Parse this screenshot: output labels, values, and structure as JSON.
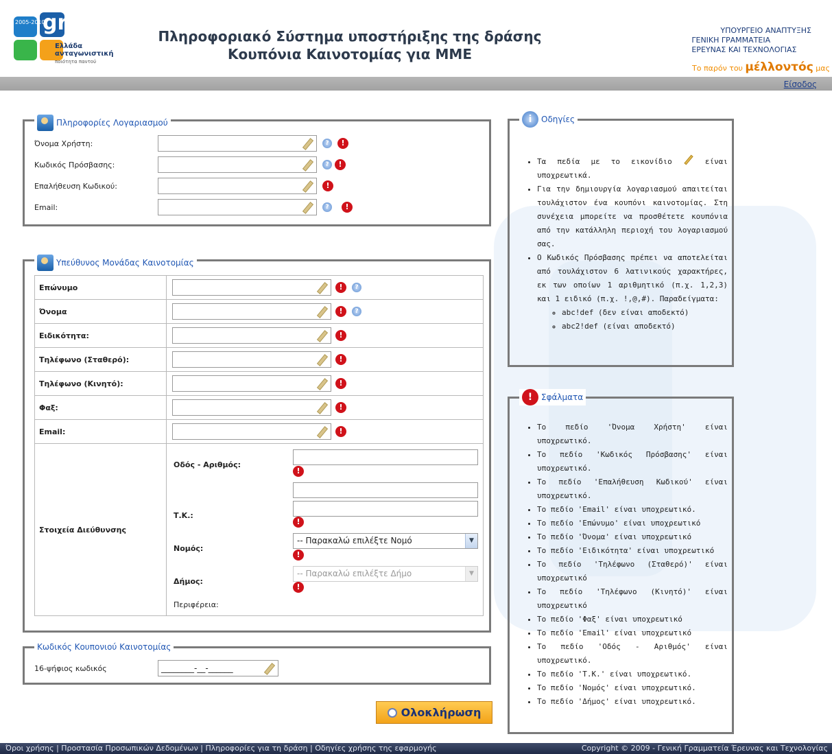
{
  "header": {
    "logo_years": "2005-2010",
    "logo_mark": "gr",
    "logo_line1": "Ελλάδα",
    "logo_line2": "ανταγωνιστική",
    "logo_line3": "ποιότητα παντού",
    "title_line1": "Πληροφοριακό Σύστημα υποστήριξης της δράσης",
    "title_line2": "Κουπόνια Καινοτομίας για ΜΜΕ",
    "ministry_line1": "ΥΠΟΥΡΓΕΙΟ ΑΝΑΠΤΥΞΗΣ",
    "ministry_line2": "ΓΕΝΙΚΗ ΓΡΑΜΜΑΤΕΙΑ",
    "ministry_line3": "ΕΡΕΥΝΑΣ ΚΑΙ ΤΕΧΝΟΛΟΓΙΑΣ",
    "motto_pre": "Το παρόν του",
    "motto_big": "μέλλοντός",
    "motto_post": "μας"
  },
  "nav": {
    "login": "Είσοδος"
  },
  "account": {
    "legend": "Πληροφορίες Λογαριασμού",
    "username_label": "Όνομα Χρήστη:",
    "password_label": "Κωδικός Πρόσβασης:",
    "confirm_label": "Επαλήθευση Κωδικού:",
    "email_label": "Email:"
  },
  "responsible": {
    "legend": "Υπεύθυνος Μονάδας Καινοτομίας",
    "surname": "Επώνυμο",
    "name": "Όνομα",
    "specialty": "Ειδικότητα:",
    "phone_fixed": "Τηλέφωνο (Σταθερό):",
    "phone_mobile": "Τηλέφωνο (Κινητό):",
    "fax": "Φαξ:",
    "email": "Email:",
    "address_header": "Στοιχεία Διεύθυνσης",
    "street": "Οδός - Αριθμός:",
    "postal": "Τ.Κ.:",
    "prefecture": "Νομός:",
    "prefecture_select": "-- Παρακαλώ επιλέξτε Νομό",
    "municipality": "Δήμος:",
    "municipality_select": "-- Παρακαλώ επιλέξτε Δήμο",
    "region": "Περιφέρεια:"
  },
  "coupon": {
    "legend": "Κωδικός Κουπονιού Καινοτομίας",
    "label": "16-ψήφιος κωδικός",
    "value": "________-__-______"
  },
  "submit_label": "Ολοκλήρωση",
  "instructions": {
    "legend": "Οδηγίες",
    "item1_a": "Τα πεδία με το εικονίδιο",
    "item1_b": "είναι υποχρεωτικά.",
    "item2": "Για την δημιουργία λογαριασμού απαιτείται τουλάχιστον ένα κουπόνι καινοτομίας. Στη συνέχεια μπορείτε να προσθέτετε κουπόνια από την κατάλληλη περιοχή του λογαριασμού σας.",
    "item3": "Ο Κωδικός Πρόσβασης πρέπει να αποτελείται από τουλάχιστον 6 λατινικούς χαρακτήρες, εκ των οποίων 1 αριθμητικό (π.χ. 1,2,3) και 1 ειδικό (π.χ. !,@,#). Παραδείγματα:",
    "ex1": "abc!def  (δεν είναι αποδεκτό)",
    "ex2": "abc2!def (είναι αποδεκτό)"
  },
  "errors": {
    "legend": "Σφάλματα",
    "items": [
      "Το πεδίο 'Όνομα Χρήστη' είναι υποχρεωτικό.",
      "Το πεδίο 'Κωδικός Πρόσβασης' είναι υποχρεωτικό.",
      "Το πεδίο 'Επαλήθευση Κωδικού' είναι υποχρεωτικό.",
      "Το πεδίο 'Email' είναι υποχρεωτικό.",
      "Το πεδίο 'Επώνυμο' είναι υποχρεωτικό",
      "Το πεδίο 'Όνομα' είναι υποχρεωτικό",
      "Το πεδίο 'Ειδικότητα' είναι υποχρεωτικό",
      "Το πεδίο 'Τηλέφωνο (Σταθερό)' είναι υποχρεωτικό",
      "Το πεδίο 'Τηλέφωνο (Κινητό)' είναι υποχρεωτικό",
      "Το πεδίο 'Φαξ' είναι υποχρεωτικό",
      "Το πεδίο 'Email' είναι υποχρεωτικό",
      "Το πεδίο 'Οδός - Αριθμός' είναι υποχρεωτικό.",
      "Το πεδίο 'Τ.Κ.' είναι υποχρεωτικό.",
      "Το πεδίο 'Νομός' είναι υποχρεωτικό.",
      "Το πεδίο 'Δήμος' είναι υποχρεωτικό."
    ]
  },
  "footer": {
    "links": "Όροι χρήσης | Προστασία Προσωπικών Δεδομένων | Πληροφορίες για τη δράση | Οδηγίες χρήσης της εφαρμογής",
    "copyright": "Copyright © 2009 - Γενική Γραμματεία Έρευνας και Τεχνολογίας"
  }
}
